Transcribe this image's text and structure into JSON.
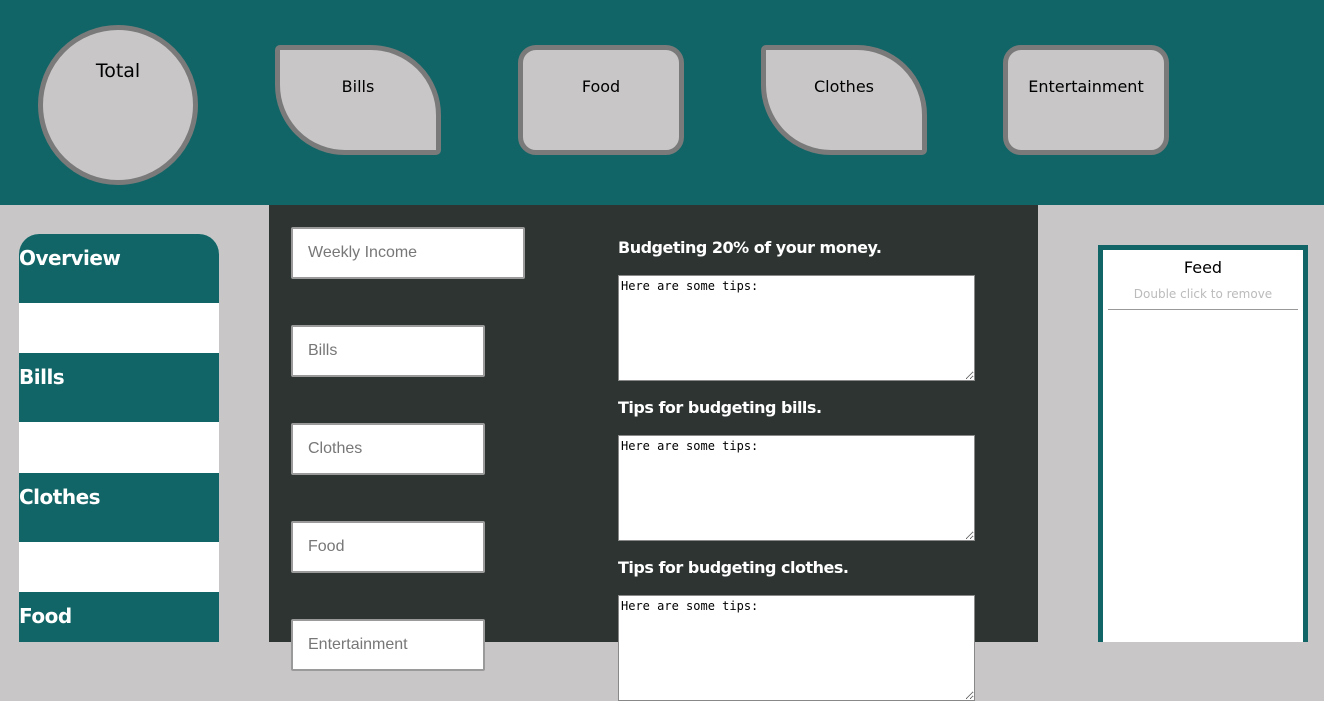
{
  "header": {
    "total": "Total",
    "categories": [
      "Bills",
      "Food",
      "Clothes",
      "Entertainment"
    ]
  },
  "sidebar": {
    "items": [
      "Overview",
      "Bills",
      "Clothes",
      "Food"
    ]
  },
  "form": {
    "weekly_income_placeholder": "Weekly Income",
    "bills_placeholder": "Bills",
    "clothes_placeholder": "Clothes",
    "food_placeholder": "Food",
    "entertainment_placeholder": "Entertainment"
  },
  "tips": [
    {
      "label": "Budgeting 20% of your money.",
      "text": "Here are some tips:"
    },
    {
      "label": "Tips for budgeting bills.",
      "text": "Here are some tips:"
    },
    {
      "label": "Tips for budgeting clothes.",
      "text": "Here are some tips:"
    }
  ],
  "feed": {
    "title": "Feed",
    "hint": "Double click to remove"
  },
  "colors": {
    "teal": "#126566",
    "dark_panel": "#2d3432",
    "gray_bg": "#c8c6c7",
    "bubble_border": "#7a7a7a"
  }
}
